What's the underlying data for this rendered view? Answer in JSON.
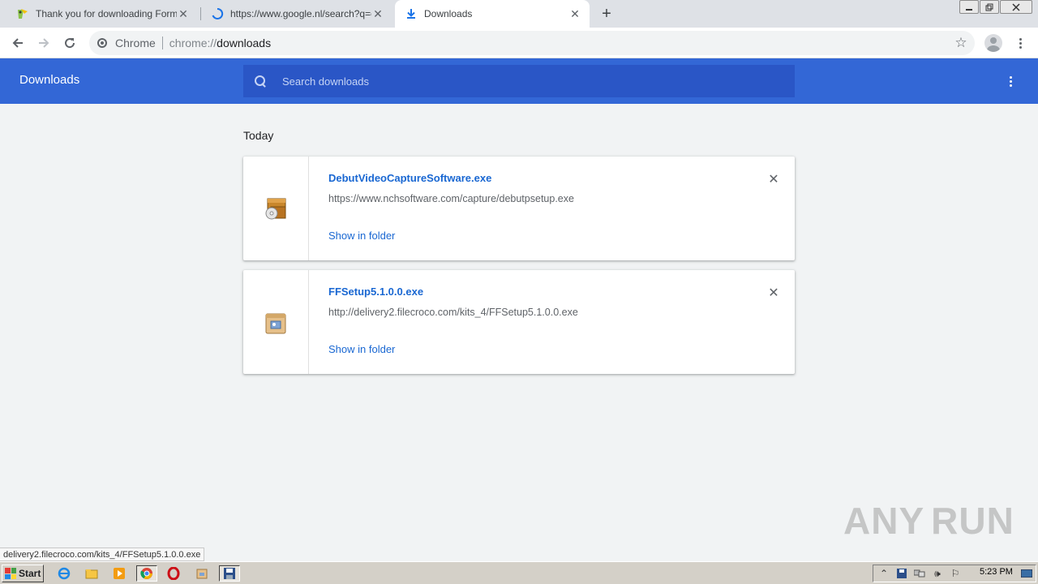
{
  "tabs": [
    {
      "title": "Thank you for downloading Format F",
      "icon": "format-factory-icon",
      "active": false
    },
    {
      "title": "https://www.google.nl/search?q=ca",
      "icon": "loading-spinner-icon",
      "active": false
    },
    {
      "title": "Downloads",
      "icon": "download-icon",
      "active": true
    }
  ],
  "toolbar": {
    "scheme_label": "Chrome",
    "url_scheme": "chrome://",
    "url_host": "downloads"
  },
  "header": {
    "title": "Downloads",
    "search_placeholder": "Search downloads"
  },
  "section": {
    "date": "Today"
  },
  "downloads": [
    {
      "filename": "DebutVideoCaptureSoftware.exe",
      "url": "https://www.nchsoftware.com/capture/debutpsetup.exe",
      "action": "Show in folder",
      "icon": "installer-disc-icon"
    },
    {
      "filename": "FFSetup5.1.0.0.exe",
      "url": "http://delivery2.filecroco.com/kits_4/FFSetup5.1.0.0.exe",
      "action": "Show in folder",
      "icon": "installer-box-icon"
    }
  ],
  "status_bar": {
    "text": "delivery2.filecroco.com/kits_4/FFSetup5.1.0.0.exe"
  },
  "watermark": {
    "left": "ANY",
    "right": "RUN"
  },
  "taskbar": {
    "start_label": "Start",
    "clock": "5:23 PM"
  },
  "colors": {
    "header_blue": "#3367d6",
    "search_blue": "#2a56c6",
    "link_blue": "#1967d2"
  }
}
